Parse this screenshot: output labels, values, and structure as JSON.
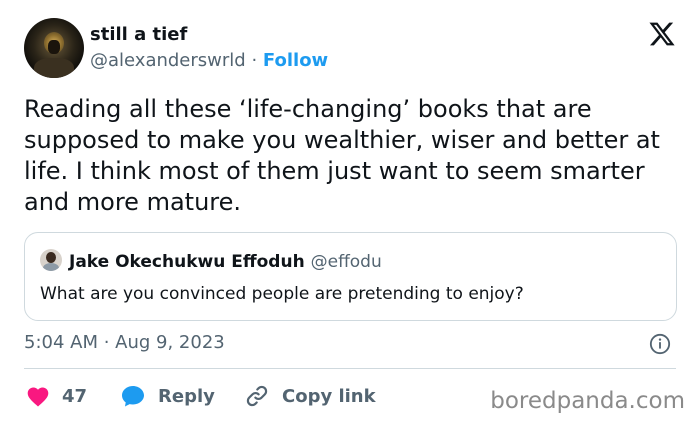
{
  "author": {
    "display_name": "still a tief",
    "handle": "@alexanderswrld",
    "separator": "·",
    "follow_label": "Follow"
  },
  "tweet": {
    "text": "Reading all these ‘life-changing’ books that are supposed to make you wealthier, wiser and better at life. I think most of them just want to seem smarter and more mature."
  },
  "quoted_tweet": {
    "author_name": "Jake Okechukwu Effoduh",
    "author_handle": "@effodu",
    "text": "What are you convinced people are pretending to enjoy?"
  },
  "timestamp": "5:04 AM · Aug 9, 2023",
  "actions": {
    "like_count": "47",
    "reply_label": "Reply",
    "copy_link_label": "Copy link"
  },
  "watermark": "boredpanda.com",
  "icons": {
    "close": "x-logo-icon",
    "info": "info-icon",
    "like": "heart-icon",
    "reply": "speech-bubble-icon",
    "copy": "link-icon"
  },
  "colors": {
    "accent": "#1d9bf0",
    "like": "#f91880",
    "secondary_text": "#536471",
    "border": "#cfd9de"
  }
}
